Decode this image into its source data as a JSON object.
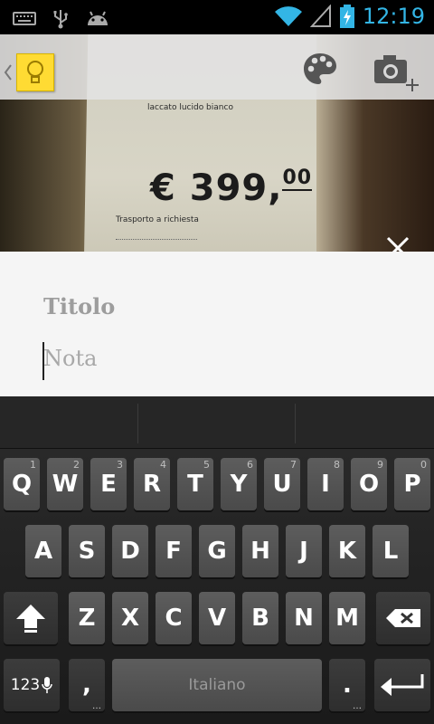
{
  "status_bar": {
    "time": "12:19",
    "icons": [
      "keyboard-icon",
      "usb-icon",
      "android-icon",
      "wifi-icon",
      "signal-icon",
      "battery-charging-icon"
    ]
  },
  "action_bar": {
    "back_icon": "chevron-left-icon",
    "logo_icon": "keep-lightbulb-icon",
    "actions": [
      "palette-icon",
      "add-photo-icon"
    ]
  },
  "photo": {
    "price_main": "€ 399,",
    "price_cents": "00",
    "line1": "laccato lucido bianco",
    "line2": "Trasporto a richiesta",
    "close_icon": "close-icon"
  },
  "note": {
    "title_placeholder": "Titolo",
    "body_placeholder": "Nota"
  },
  "keyboard": {
    "row1": [
      {
        "label": "Q",
        "hint": "1"
      },
      {
        "label": "W",
        "hint": "2"
      },
      {
        "label": "E",
        "hint": "3"
      },
      {
        "label": "R",
        "hint": "4"
      },
      {
        "label": "T",
        "hint": "5"
      },
      {
        "label": "Y",
        "hint": "6"
      },
      {
        "label": "U",
        "hint": "7"
      },
      {
        "label": "I",
        "hint": "8"
      },
      {
        "label": "O",
        "hint": "9"
      },
      {
        "label": "P",
        "hint": "0"
      }
    ],
    "row2": [
      "A",
      "S",
      "D",
      "F",
      "G",
      "H",
      "J",
      "K",
      "L"
    ],
    "row3": [
      "Z",
      "X",
      "C",
      "V",
      "B",
      "N",
      "M"
    ],
    "shift_icon": "shift-arrow-icon",
    "backspace_icon": "backspace-icon",
    "mode_key": "123",
    "mic_icon": "microphone-icon",
    "comma": ",",
    "space_label": "Italiano",
    "period": ".",
    "enter_icon": "enter-icon"
  },
  "colors": {
    "clock": "#33b5e5",
    "keep_yellow": "#ffdb33",
    "note_bg": "#f5f5f5",
    "key_bg": "#555555"
  }
}
